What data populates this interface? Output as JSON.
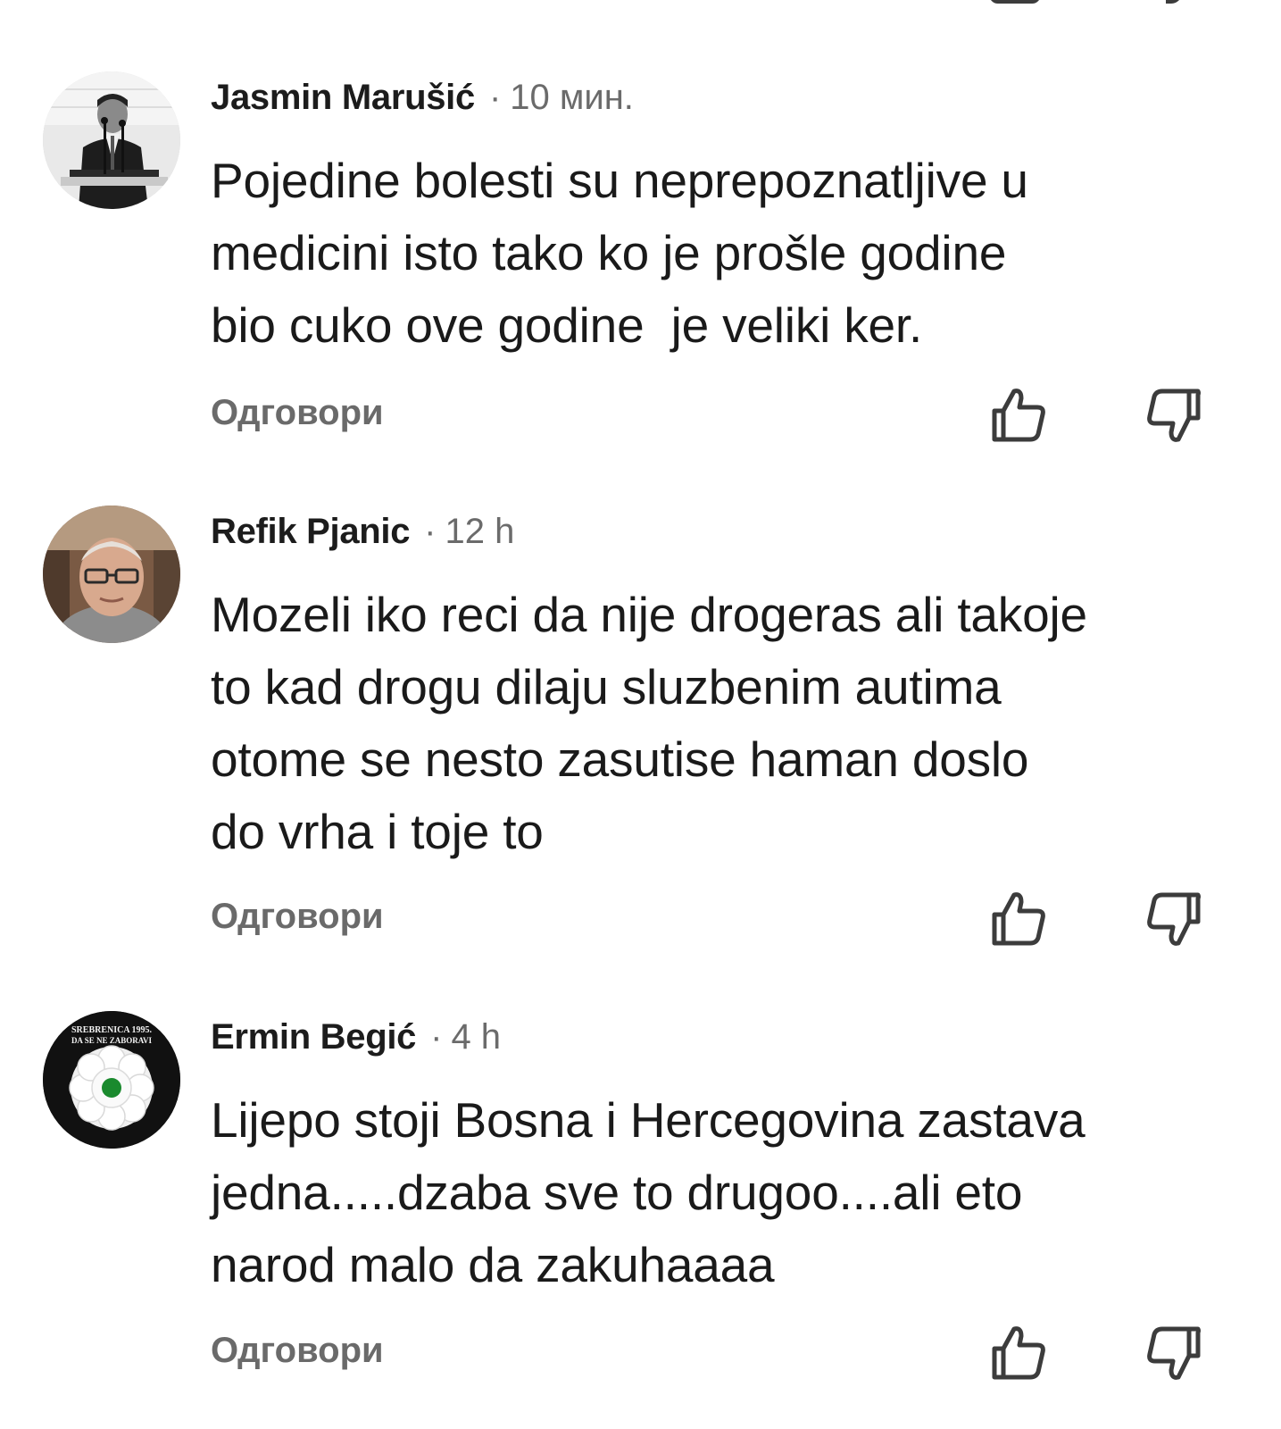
{
  "comments": [
    {
      "author": "Jasmin Marušić",
      "separator": "·",
      "time": "10 мин.",
      "text": "Pojedine bolesti su neprepoznatljive u\nmedicini isto tako ko je prošle godine\nbio cuko ove godine  je veliki ker.",
      "reply_label": "Одговори",
      "avatar": "photo-man-at-podium-grayscale"
    },
    {
      "author": "Refik Pjanic",
      "separator": "·",
      "time": "12 h",
      "text": "Mozeli iko reci da nije drogeras ali takoje\nto kad drogu dilaju sluzbenim autima\notome se nesto zasutise haman doslo\ndo vrha i toje to",
      "reply_label": "Одговори",
      "avatar": "photo-man-with-glasses"
    },
    {
      "author": "Ermin Begić",
      "separator": "·",
      "time": "4 h",
      "text": "Lijepo stoji Bosna i Hercegovina zastava\njedna.....dzaba sve to drugoo....ali eto\nnarod malo da zakuhaaaa",
      "reply_label": "Одговори",
      "avatar": "srebrenica-flower-logo",
      "avatar_text_line1": "SREBRENICA 1995.",
      "avatar_text_line2": "DA SE NE ZABORAVI"
    }
  ],
  "icons": {
    "like": "thumbs-up-icon",
    "dislike": "thumbs-down-icon"
  },
  "colors": {
    "text": "#1a1a1a",
    "meta": "#6b6b6b",
    "reply": "#6a6a6a",
    "icon": "#3c3c3c",
    "flower_center": "#1a8a2e"
  }
}
